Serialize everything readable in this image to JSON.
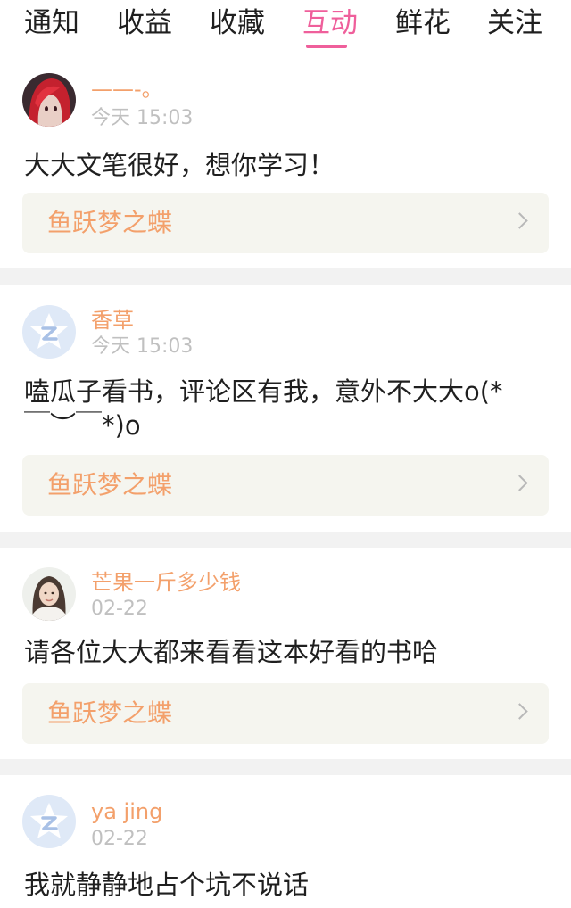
{
  "tabs": [
    {
      "label": "通知",
      "active": false
    },
    {
      "label": "收益",
      "active": false
    },
    {
      "label": "收藏",
      "active": false
    },
    {
      "label": "互动",
      "active": true
    },
    {
      "label": "鲜花",
      "active": false
    },
    {
      "label": "关注",
      "active": false
    }
  ],
  "colors": {
    "accent": "#ef5f9b",
    "username": "#f3a06b",
    "time": "#c0c0c0",
    "book_bg": "#f5f5ef",
    "separator": "#f2f2f2"
  },
  "items": [
    {
      "avatar": "red-hair-anime-avatar",
      "username": "——-。",
      "time": "今天 15:03",
      "comment": "大大文笔很好，想你学习！",
      "book": "鱼跃梦之蝶"
    },
    {
      "avatar": "default-star-avatar",
      "username": "香草",
      "time": "今天 15:03",
      "comment": "嗑瓜子看书，评论区有我，意外不大大o(*￣︶￣*)o",
      "book": "鱼跃梦之蝶"
    },
    {
      "avatar": "woman-photo-avatar",
      "username": "芒果一斤多少钱",
      "time": "02-22",
      "comment": "请各位大大都来看看这本好看的书哈",
      "book": "鱼跃梦之蝶"
    },
    {
      "avatar": "default-star-avatar",
      "username": "ya jing",
      "time": "02-22",
      "comment": "我就静静地占个坑不说话"
    }
  ]
}
